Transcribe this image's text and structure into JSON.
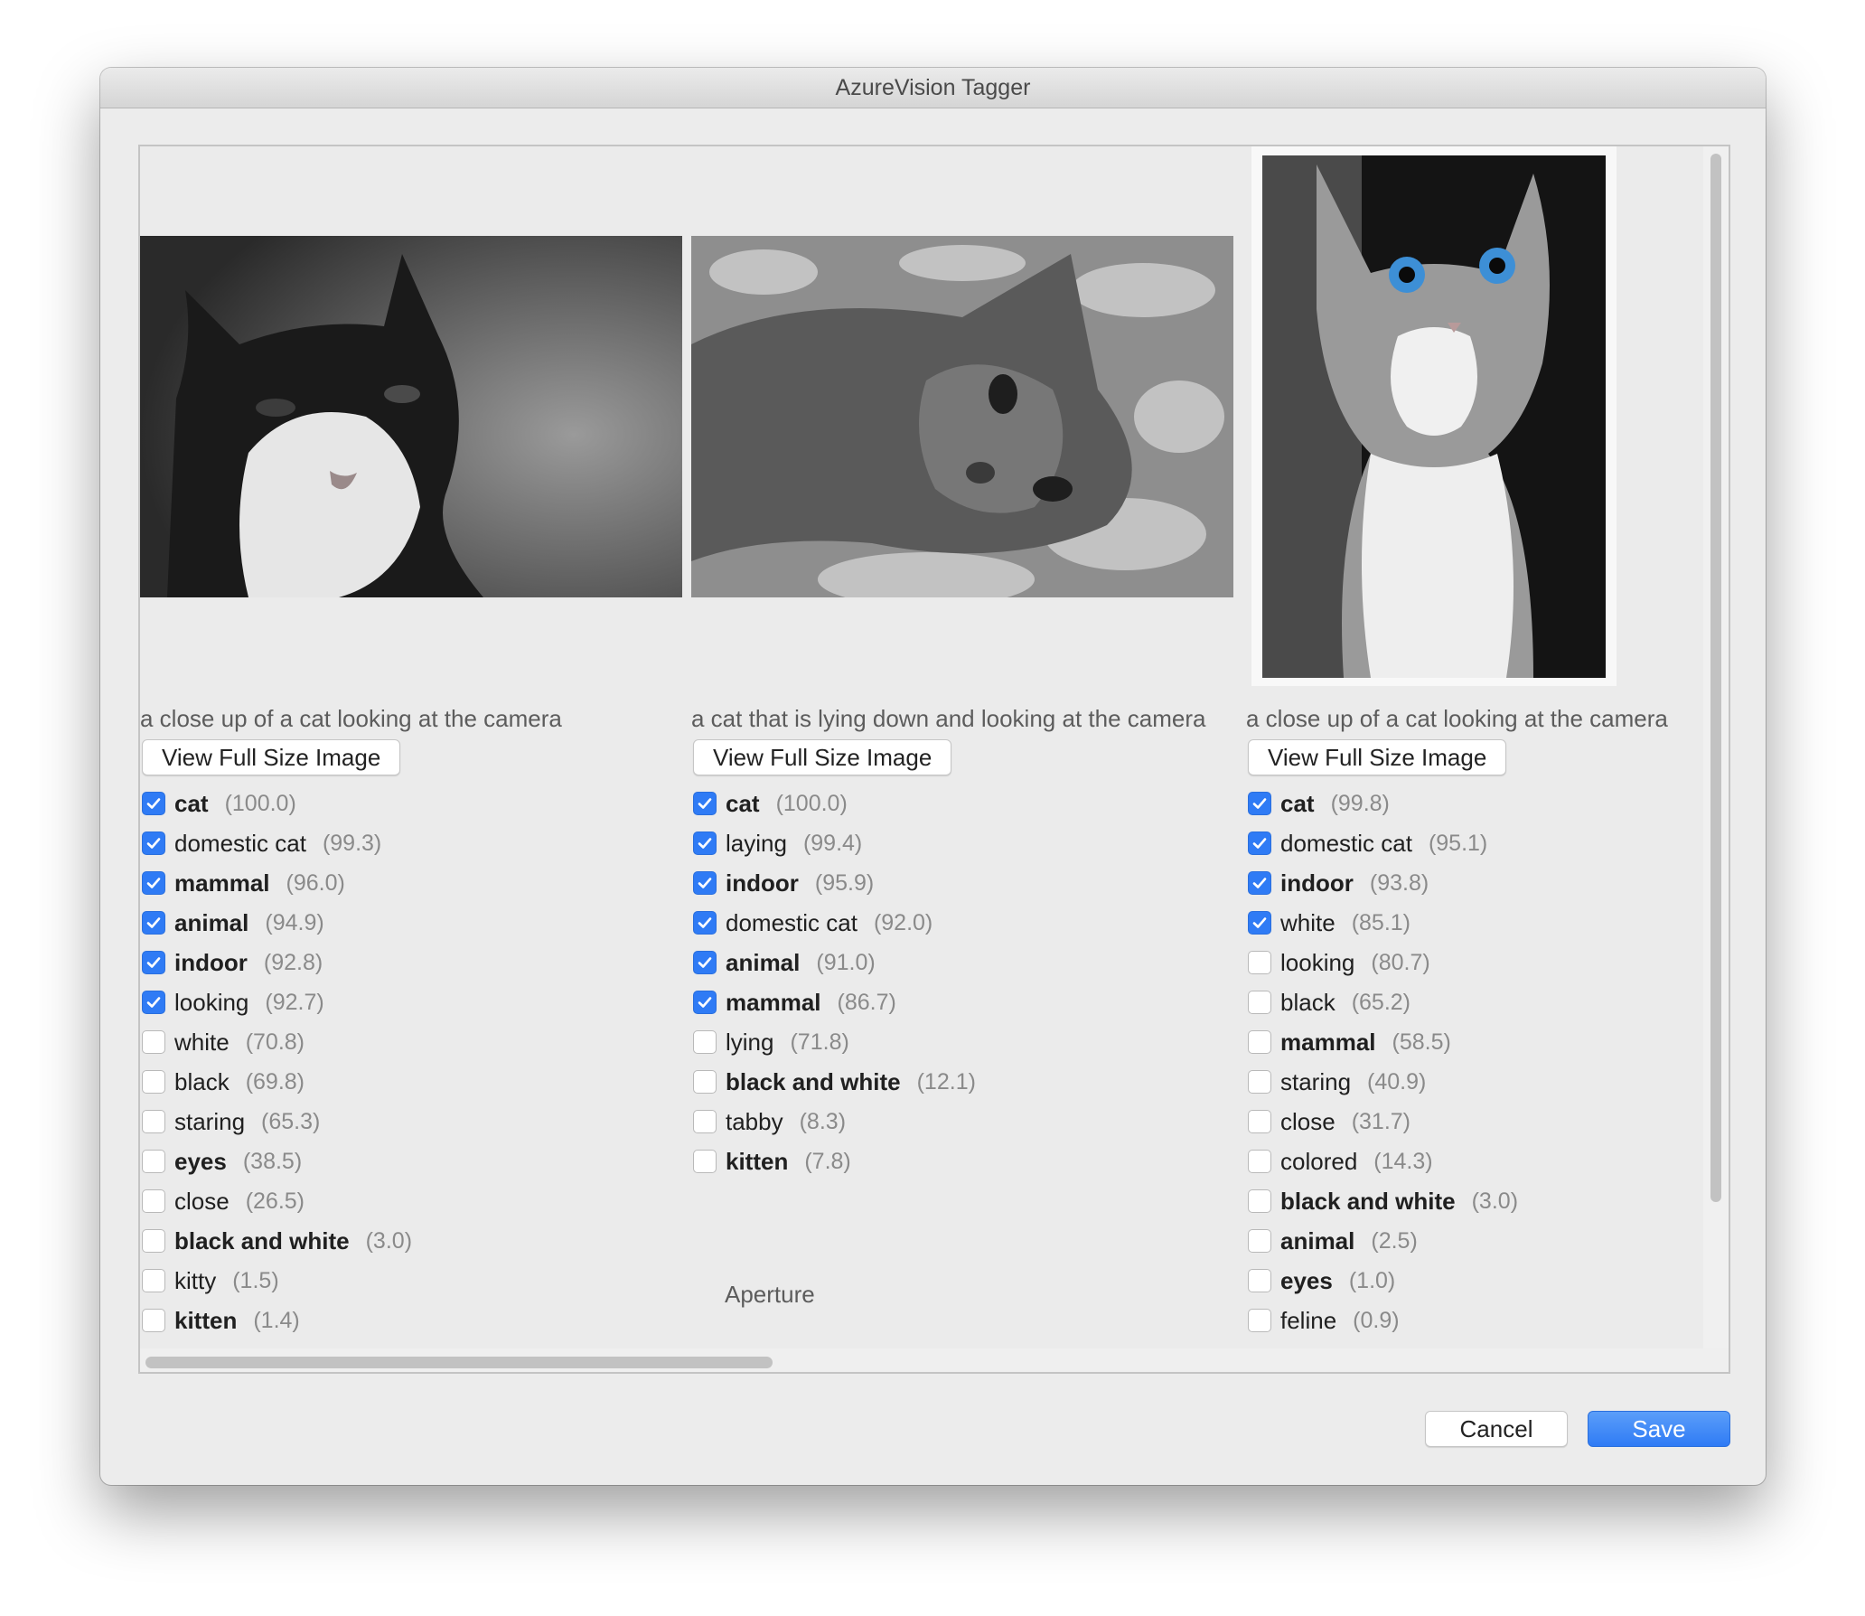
{
  "window": {
    "title": "AzureVision Tagger"
  },
  "images": [
    {
      "caption": "a close up of a cat looking at the camera",
      "view_button": "View Full Size Image",
      "tags": [
        {
          "name": "cat",
          "score": "(100.0)",
          "checked": true,
          "bold": true
        },
        {
          "name": "domestic cat",
          "score": "(99.3)",
          "checked": true,
          "bold": false
        },
        {
          "name": "mammal",
          "score": "(96.0)",
          "checked": true,
          "bold": true
        },
        {
          "name": "animal",
          "score": "(94.9)",
          "checked": true,
          "bold": true
        },
        {
          "name": "indoor",
          "score": "(92.8)",
          "checked": true,
          "bold": true
        },
        {
          "name": "looking",
          "score": "(92.7)",
          "checked": true,
          "bold": false
        },
        {
          "name": "white",
          "score": "(70.8)",
          "checked": false,
          "bold": false
        },
        {
          "name": "black",
          "score": "(69.8)",
          "checked": false,
          "bold": false
        },
        {
          "name": "staring",
          "score": "(65.3)",
          "checked": false,
          "bold": false
        },
        {
          "name": "eyes",
          "score": "(38.5)",
          "checked": false,
          "bold": true
        },
        {
          "name": "close",
          "score": "(26.5)",
          "checked": false,
          "bold": false
        },
        {
          "name": "black and white",
          "score": "(3.0)",
          "checked": false,
          "bold": true
        },
        {
          "name": "kitty",
          "score": "(1.5)",
          "checked": false,
          "bold": false
        },
        {
          "name": "kitten",
          "score": "(1.4)",
          "checked": false,
          "bold": true
        }
      ]
    },
    {
      "caption": "a cat that is lying down and looking at the camera",
      "view_button": "View Full Size Image",
      "tags": [
        {
          "name": "cat",
          "score": "(100.0)",
          "checked": true,
          "bold": true
        },
        {
          "name": "laying",
          "score": "(99.4)",
          "checked": true,
          "bold": false
        },
        {
          "name": "indoor",
          "score": "(95.9)",
          "checked": true,
          "bold": true
        },
        {
          "name": "domestic cat",
          "score": "(92.0)",
          "checked": true,
          "bold": false
        },
        {
          "name": "animal",
          "score": "(91.0)",
          "checked": true,
          "bold": true
        },
        {
          "name": "mammal",
          "score": "(86.7)",
          "checked": true,
          "bold": true
        },
        {
          "name": "lying",
          "score": "(71.8)",
          "checked": false,
          "bold": false
        },
        {
          "name": "black and white",
          "score": "(12.1)",
          "checked": false,
          "bold": true
        },
        {
          "name": "tabby",
          "score": "(8.3)",
          "checked": false,
          "bold": false
        },
        {
          "name": "kitten",
          "score": "(7.8)",
          "checked": false,
          "bold": true
        }
      ],
      "extra_label": "Aperture"
    },
    {
      "caption": "a close up of a cat looking at the camera",
      "view_button": "View Full Size Image",
      "tags": [
        {
          "name": "cat",
          "score": "(99.8)",
          "checked": true,
          "bold": true
        },
        {
          "name": "domestic cat",
          "score": "(95.1)",
          "checked": true,
          "bold": false
        },
        {
          "name": "indoor",
          "score": "(93.8)",
          "checked": true,
          "bold": true
        },
        {
          "name": "white",
          "score": "(85.1)",
          "checked": true,
          "bold": false
        },
        {
          "name": "looking",
          "score": "(80.7)",
          "checked": false,
          "bold": false
        },
        {
          "name": "black",
          "score": "(65.2)",
          "checked": false,
          "bold": false
        },
        {
          "name": "mammal",
          "score": "(58.5)",
          "checked": false,
          "bold": true
        },
        {
          "name": "staring",
          "score": "(40.9)",
          "checked": false,
          "bold": false
        },
        {
          "name": "close",
          "score": "(31.7)",
          "checked": false,
          "bold": false
        },
        {
          "name": "colored",
          "score": "(14.3)",
          "checked": false,
          "bold": false
        },
        {
          "name": "black and white",
          "score": "(3.0)",
          "checked": false,
          "bold": true
        },
        {
          "name": "animal",
          "score": "(2.5)",
          "checked": false,
          "bold": true
        },
        {
          "name": "eyes",
          "score": "(1.0)",
          "checked": false,
          "bold": true
        },
        {
          "name": "feline",
          "score": "(0.9)",
          "checked": false,
          "bold": false
        }
      ]
    }
  ],
  "footer": {
    "cancel_label": "Cancel",
    "save_label": "Save"
  },
  "colors": {
    "accent": "#2f7bf5",
    "window_bg": "#ececec"
  },
  "icons": {
    "checkbox_checked": "checkmark-icon"
  }
}
